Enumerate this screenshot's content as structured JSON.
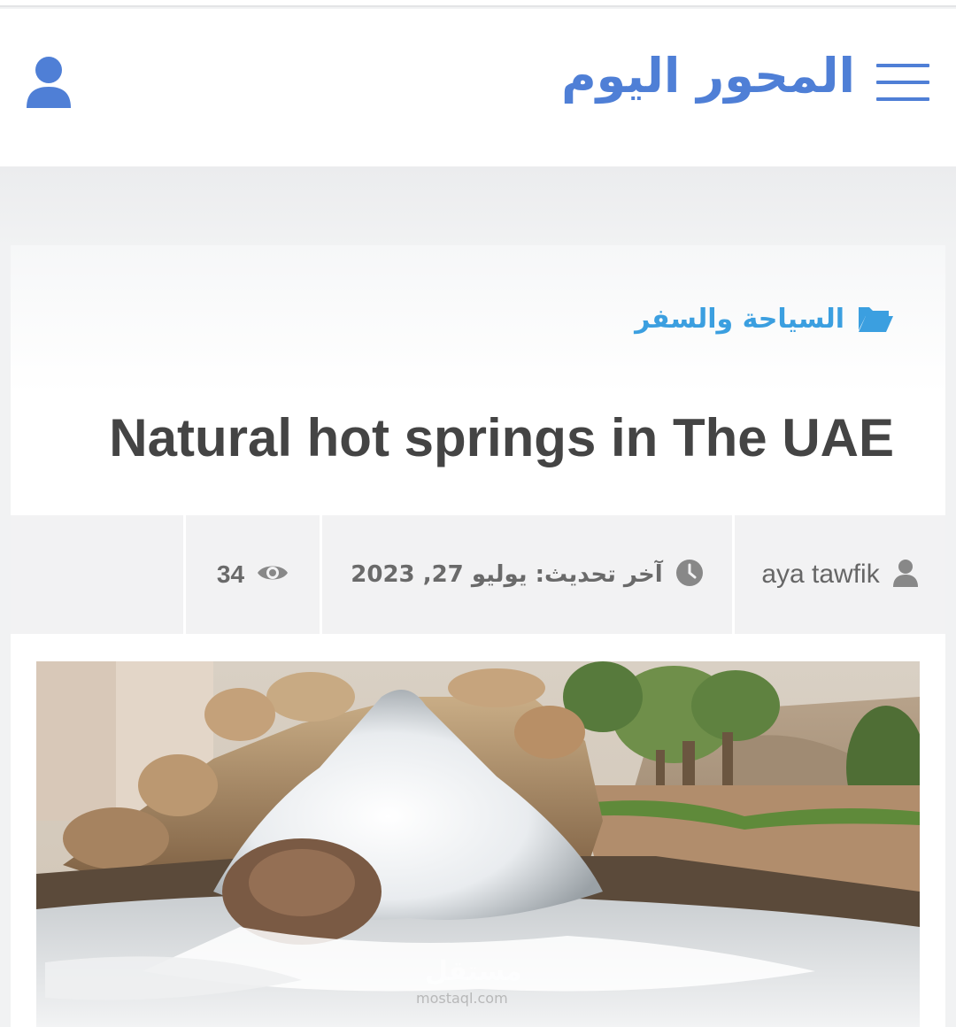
{
  "header": {
    "site_title": "المحور اليوم",
    "menu_icon": "hamburger-menu-icon",
    "user_icon": "user-icon",
    "brand_color": "#4f7fd6"
  },
  "article": {
    "category": "السياحة والسفر",
    "category_icon": "folder-open-icon",
    "category_color": "#3b9fe0",
    "title": "Natural hot springs in The UAE"
  },
  "meta": {
    "author": "aya tawfik",
    "author_icon": "user-icon",
    "last_updated": "آخر تحديث:  يوليو 27, 2023",
    "clock_icon": "clock-icon",
    "views": "34",
    "views_icon": "eye-icon"
  },
  "image": {
    "alt": "hot spring waterfall",
    "watermark": "مستقل",
    "watermark_url": "mostaql.com"
  }
}
